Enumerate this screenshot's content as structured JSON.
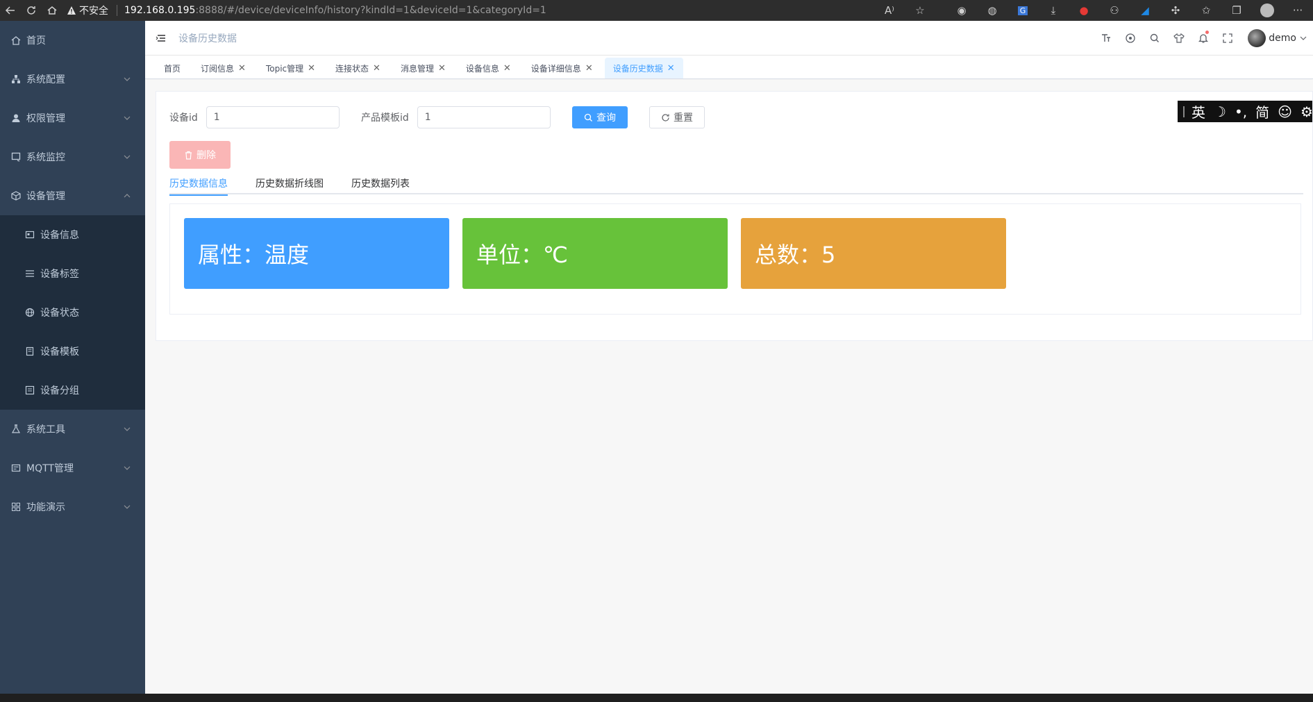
{
  "browser": {
    "security_label": "不安全",
    "url_host": "192.168.0.195",
    "url_rest": ":8888/#/device/deviceInfo/history?kindId=1&deviceId=1&categoryId=1"
  },
  "sidebar": {
    "items": [
      {
        "label": "首页",
        "icon": "home-icon"
      },
      {
        "label": "系统配置",
        "icon": "sitemap-icon"
      },
      {
        "label": "权限管理",
        "icon": "user-icon"
      },
      {
        "label": "系统监控",
        "icon": "monitor-icon"
      },
      {
        "label": "设备管理",
        "icon": "cube-icon"
      },
      {
        "label": "系统工具",
        "icon": "flask-icon"
      },
      {
        "label": "MQTT管理",
        "icon": "server-icon"
      },
      {
        "label": "功能演示",
        "icon": "grid-icon"
      }
    ],
    "sub_items": [
      {
        "label": "设备信息",
        "icon": "device-icon"
      },
      {
        "label": "设备标签",
        "icon": "list-icon"
      },
      {
        "label": "设备状态",
        "icon": "globe-icon"
      },
      {
        "label": "设备模板",
        "icon": "template-icon"
      },
      {
        "label": "设备分组",
        "icon": "group-icon"
      }
    ]
  },
  "navbar": {
    "breadcrumb": "设备历史数据",
    "username": "demo"
  },
  "tags": [
    {
      "label": "首页",
      "closable": false
    },
    {
      "label": "订阅信息",
      "closable": true
    },
    {
      "label": "Topic管理",
      "closable": true
    },
    {
      "label": "连接状态",
      "closable": true
    },
    {
      "label": "消息管理",
      "closable": true
    },
    {
      "label": "设备信息",
      "closable": true
    },
    {
      "label": "设备详细信息",
      "closable": true
    },
    {
      "label": "设备历史数据",
      "closable": true,
      "active": true
    }
  ],
  "form": {
    "device_id_label": "设备id",
    "device_id_value": "1",
    "template_id_label": "产品模板id",
    "template_id_value": "1",
    "query_label": "查询",
    "reset_label": "重置",
    "delete_label": "删除"
  },
  "ime": {
    "items": [
      "英",
      "☽",
      "•,",
      "简",
      "☺",
      "⚙"
    ]
  },
  "tabs": [
    {
      "label": "历史数据信息",
      "active": true
    },
    {
      "label": "历史数据折线图",
      "active": false
    },
    {
      "label": "历史数据列表",
      "active": false
    }
  ],
  "stats": [
    {
      "text": "属性：温度",
      "color": "#409eff"
    },
    {
      "text": "单位：℃",
      "color": "#67c23a"
    },
    {
      "text": "总数：5",
      "color": "#e6a23c"
    }
  ],
  "colors": {
    "primary": "#409eff",
    "sidebar_bg": "#304156",
    "sidebar_sub_bg": "#1f2d3d",
    "danger_light": "#fab6b6"
  }
}
